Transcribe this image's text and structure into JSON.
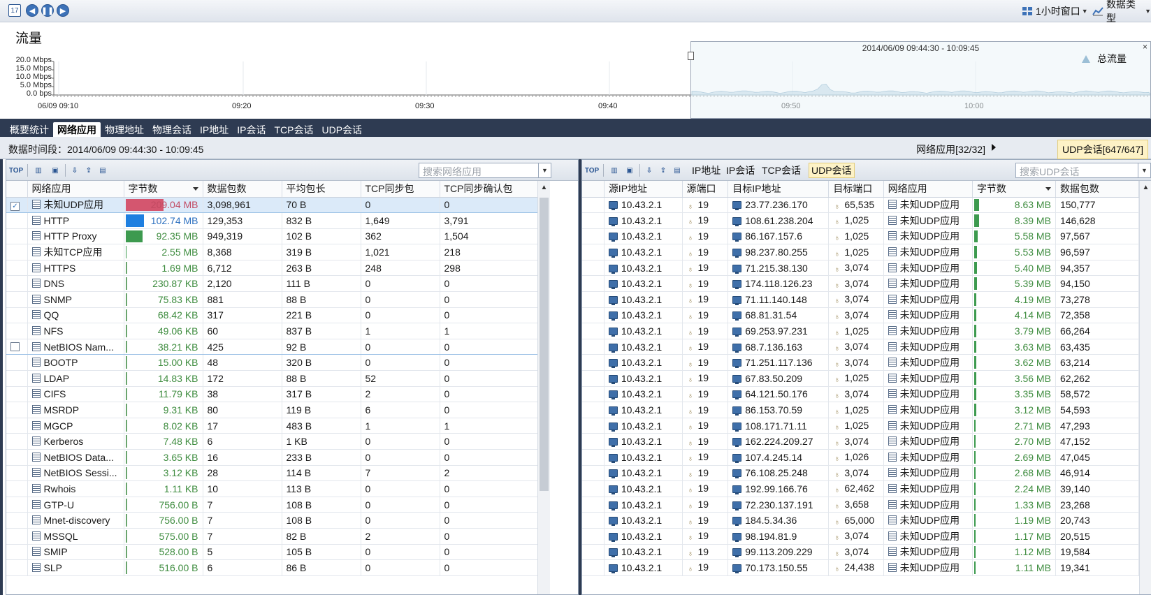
{
  "toolbar": {
    "window_label": "1小时窗口",
    "datatype_label": "数据类型"
  },
  "chart": {
    "title": "流量",
    "range_label": "2014/06/09  09:44:30 - 10:09:45",
    "legend_label": "总流量",
    "legend_color": "#9cbfd6",
    "y_ticks": [
      "20.0 Mbps",
      "15.0 Mbps",
      "10.0 Mbps",
      "5.0 Mbps",
      "0.0 bps"
    ],
    "x_ticks": [
      "06/09 09:10",
      "09:20",
      "09:30",
      "09:40",
      "09:50",
      "10:00"
    ]
  },
  "nav": {
    "tabs": [
      "概要统计",
      "网络应用",
      "物理地址",
      "物理会话",
      "IP地址",
      "IP会话",
      "TCP会话",
      "UDP会话"
    ],
    "active_index": 1
  },
  "timebar": {
    "period": "数据时间段：2014/06/09  09:44:30 - 10:09:45",
    "crumb_app": "网络应用[32/32]",
    "crumb_udp": "UDP会话[647/647]"
  },
  "left": {
    "search_placeholder": "搜索网络应用",
    "columns": [
      "网络应用",
      "字节数",
      "数据包数",
      "平均包长",
      "TCP同步包",
      "TCP同步确认包"
    ],
    "rows": [
      {
        "name": "未知UDP应用",
        "bytes": "209.04 MB",
        "bar": 1.0,
        "bar_color": "#d4566f",
        "packets": "3,098,961",
        "avg": "70 B",
        "syn": "0",
        "synack": "0",
        "checked": true,
        "selected": true
      },
      {
        "name": "HTTP",
        "bytes": "102.74 MB",
        "bar": 0.49,
        "bar_color": "#1e7fe0",
        "packets": "129,353",
        "avg": "832 B",
        "syn": "1,649",
        "synack": "3,791"
      },
      {
        "name": "HTTP Proxy",
        "bytes": "92.35 MB",
        "bar": 0.44,
        "bar_color": "#3d9a4f",
        "packets": "949,319",
        "avg": "102 B",
        "syn": "362",
        "synack": "1,504"
      },
      {
        "name": "未知TCP应用",
        "bytes": "2.55 MB",
        "bar": 0.012,
        "bar_color": "#3d9a4f",
        "packets": "8,368",
        "avg": "319 B",
        "syn": "1,021",
        "synack": "218"
      },
      {
        "name": "HTTPS",
        "bytes": "1.69 MB",
        "bar": 0.008,
        "bar_color": "#3d9a4f",
        "packets": "6,712",
        "avg": "263 B",
        "syn": "248",
        "synack": "298"
      },
      {
        "name": "DNS",
        "bytes": "230.87 KB",
        "bar": 0.001,
        "bar_color": "#3d9a4f",
        "packets": "2,120",
        "avg": "111 B",
        "syn": "0",
        "synack": "0"
      },
      {
        "name": "SNMP",
        "bytes": "75.83 KB",
        "bar": 0,
        "bar_color": "#3d9a4f",
        "packets": "881",
        "avg": "88 B",
        "syn": "0",
        "synack": "0"
      },
      {
        "name": "QQ",
        "bytes": "68.42 KB",
        "bar": 0,
        "bar_color": "#3d9a4f",
        "packets": "317",
        "avg": "221 B",
        "syn": "0",
        "synack": "0"
      },
      {
        "name": "NFS",
        "bytes": "49.06 KB",
        "bar": 0,
        "bar_color": "#3d9a4f",
        "packets": "60",
        "avg": "837 B",
        "syn": "1",
        "synack": "1"
      },
      {
        "name": "NetBIOS Nam...",
        "bytes": "38.21 KB",
        "bar": 0,
        "bar_color": "#3d9a4f",
        "packets": "425",
        "avg": "92 B",
        "syn": "0",
        "synack": "0",
        "checked": false,
        "hover": true
      },
      {
        "name": "BOOTP",
        "bytes": "15.00 KB",
        "bar": 0,
        "bar_color": "#3d9a4f",
        "packets": "48",
        "avg": "320 B",
        "syn": "0",
        "synack": "0"
      },
      {
        "name": "LDAP",
        "bytes": "14.83 KB",
        "bar": 0,
        "bar_color": "#3d9a4f",
        "packets": "172",
        "avg": "88 B",
        "syn": "52",
        "synack": "0"
      },
      {
        "name": "CIFS",
        "bytes": "11.79 KB",
        "bar": 0,
        "bar_color": "#3d9a4f",
        "packets": "38",
        "avg": "317 B",
        "syn": "2",
        "synack": "0"
      },
      {
        "name": "MSRDP",
        "bytes": "9.31 KB",
        "bar": 0,
        "bar_color": "#3d9a4f",
        "packets": "80",
        "avg": "119 B",
        "syn": "6",
        "synack": "0"
      },
      {
        "name": "MGCP",
        "bytes": "8.02 KB",
        "bar": 0,
        "bar_color": "#3d9a4f",
        "packets": "17",
        "avg": "483 B",
        "syn": "1",
        "synack": "1"
      },
      {
        "name": "Kerberos",
        "bytes": "7.48 KB",
        "bar": 0,
        "bar_color": "#3d9a4f",
        "packets": "6",
        "avg": "1 KB",
        "syn": "0",
        "synack": "0"
      },
      {
        "name": "NetBIOS Data...",
        "bytes": "3.65 KB",
        "bar": 0,
        "bar_color": "#3d9a4f",
        "packets": "16",
        "avg": "233 B",
        "syn": "0",
        "synack": "0"
      },
      {
        "name": "NetBIOS Sessi...",
        "bytes": "3.12 KB",
        "bar": 0,
        "bar_color": "#3d9a4f",
        "packets": "28",
        "avg": "114 B",
        "syn": "7",
        "synack": "2"
      },
      {
        "name": "Rwhois",
        "bytes": "1.11 KB",
        "bar": 0,
        "bar_color": "#3d9a4f",
        "packets": "10",
        "avg": "113 B",
        "syn": "0",
        "synack": "0"
      },
      {
        "name": "GTP-U",
        "bytes": "756.00 B",
        "bar": 0,
        "bar_color": "#3d9a4f",
        "packets": "7",
        "avg": "108 B",
        "syn": "0",
        "synack": "0"
      },
      {
        "name": "Mnet-discovery",
        "bytes": "756.00 B",
        "bar": 0,
        "bar_color": "#3d9a4f",
        "packets": "7",
        "avg": "108 B",
        "syn": "0",
        "synack": "0"
      },
      {
        "name": "MSSQL",
        "bytes": "575.00 B",
        "bar": 0,
        "bar_color": "#3d9a4f",
        "packets": "7",
        "avg": "82 B",
        "syn": "2",
        "synack": "0"
      },
      {
        "name": "SMIP",
        "bytes": "528.00 B",
        "bar": 0,
        "bar_color": "#3d9a4f",
        "packets": "5",
        "avg": "105 B",
        "syn": "0",
        "synack": "0"
      },
      {
        "name": "SLP",
        "bytes": "516.00 B",
        "bar": 0,
        "bar_color": "#3d9a4f",
        "packets": "6",
        "avg": "86 B",
        "syn": "0",
        "synack": "0"
      }
    ]
  },
  "right": {
    "subtabs": [
      "IP地址",
      "IP会话",
      "TCP会话",
      "UDP会话"
    ],
    "active_subtab": 3,
    "search_placeholder": "搜索UDP会话",
    "columns": [
      "源IP地址",
      "源端口",
      "目标IP地址",
      "目标端口",
      "网络应用",
      "字节数",
      "数据包数"
    ],
    "rows": [
      {
        "src": "10.43.2.1",
        "sport": "19",
        "dst": "23.77.236.170",
        "dport": "65,535",
        "app": "未知UDP应用",
        "bytes": "8.63 MB",
        "packets": "150,777"
      },
      {
        "src": "10.43.2.1",
        "sport": "19",
        "dst": "108.61.238.204",
        "dport": "1,025",
        "app": "未知UDP应用",
        "bytes": "8.39 MB",
        "packets": "146,628"
      },
      {
        "src": "10.43.2.1",
        "sport": "19",
        "dst": "86.167.157.6",
        "dport": "1,025",
        "app": "未知UDP应用",
        "bytes": "5.58 MB",
        "packets": "97,567"
      },
      {
        "src": "10.43.2.1",
        "sport": "19",
        "dst": "98.237.80.255",
        "dport": "1,025",
        "app": "未知UDP应用",
        "bytes": "5.53 MB",
        "packets": "96,597"
      },
      {
        "src": "10.43.2.1",
        "sport": "19",
        "dst": "71.215.38.130",
        "dport": "3,074",
        "app": "未知UDP应用",
        "bytes": "5.40 MB",
        "packets": "94,357"
      },
      {
        "src": "10.43.2.1",
        "sport": "19",
        "dst": "174.118.126.23",
        "dport": "3,074",
        "app": "未知UDP应用",
        "bytes": "5.39 MB",
        "packets": "94,150"
      },
      {
        "src": "10.43.2.1",
        "sport": "19",
        "dst": "71.11.140.148",
        "dport": "3,074",
        "app": "未知UDP应用",
        "bytes": "4.19 MB",
        "packets": "73,278"
      },
      {
        "src": "10.43.2.1",
        "sport": "19",
        "dst": "68.81.31.54",
        "dport": "3,074",
        "app": "未知UDP应用",
        "bytes": "4.14 MB",
        "packets": "72,358"
      },
      {
        "src": "10.43.2.1",
        "sport": "19",
        "dst": "69.253.97.231",
        "dport": "1,025",
        "app": "未知UDP应用",
        "bytes": "3.79 MB",
        "packets": "66,264"
      },
      {
        "src": "10.43.2.1",
        "sport": "19",
        "dst": "68.7.136.163",
        "dport": "3,074",
        "app": "未知UDP应用",
        "bytes": "3.63 MB",
        "packets": "63,435"
      },
      {
        "src": "10.43.2.1",
        "sport": "19",
        "dst": "71.251.117.136",
        "dport": "3,074",
        "app": "未知UDP应用",
        "bytes": "3.62 MB",
        "packets": "63,214"
      },
      {
        "src": "10.43.2.1",
        "sport": "19",
        "dst": "67.83.50.209",
        "dport": "1,025",
        "app": "未知UDP应用",
        "bytes": "3.56 MB",
        "packets": "62,262"
      },
      {
        "src": "10.43.2.1",
        "sport": "19",
        "dst": "64.121.50.176",
        "dport": "3,074",
        "app": "未知UDP应用",
        "bytes": "3.35 MB",
        "packets": "58,572"
      },
      {
        "src": "10.43.2.1",
        "sport": "19",
        "dst": "86.153.70.59",
        "dport": "1,025",
        "app": "未知UDP应用",
        "bytes": "3.12 MB",
        "packets": "54,593"
      },
      {
        "src": "10.43.2.1",
        "sport": "19",
        "dst": "108.171.71.11",
        "dport": "1,025",
        "app": "未知UDP应用",
        "bytes": "2.71 MB",
        "packets": "47,293"
      },
      {
        "src": "10.43.2.1",
        "sport": "19",
        "dst": "162.224.209.27",
        "dport": "3,074",
        "app": "未知UDP应用",
        "bytes": "2.70 MB",
        "packets": "47,152"
      },
      {
        "src": "10.43.2.1",
        "sport": "19",
        "dst": "107.4.245.14",
        "dport": "1,026",
        "app": "未知UDP应用",
        "bytes": "2.69 MB",
        "packets": "47,045"
      },
      {
        "src": "10.43.2.1",
        "sport": "19",
        "dst": "76.108.25.248",
        "dport": "3,074",
        "app": "未知UDP应用",
        "bytes": "2.68 MB",
        "packets": "46,914"
      },
      {
        "src": "10.43.2.1",
        "sport": "19",
        "dst": "192.99.166.76",
        "dport": "62,462",
        "app": "未知UDP应用",
        "bytes": "2.24 MB",
        "packets": "39,140"
      },
      {
        "src": "10.43.2.1",
        "sport": "19",
        "dst": "72.230.137.191",
        "dport": "3,658",
        "app": "未知UDP应用",
        "bytes": "1.33 MB",
        "packets": "23,268"
      },
      {
        "src": "10.43.2.1",
        "sport": "19",
        "dst": "184.5.34.36",
        "dport": "65,000",
        "app": "未知UDP应用",
        "bytes": "1.19 MB",
        "packets": "20,743"
      },
      {
        "src": "10.43.2.1",
        "sport": "19",
        "dst": "98.194.81.9",
        "dport": "3,074",
        "app": "未知UDP应用",
        "bytes": "1.17 MB",
        "packets": "20,515"
      },
      {
        "src": "10.43.2.1",
        "sport": "19",
        "dst": "99.113.209.229",
        "dport": "3,074",
        "app": "未知UDP应用",
        "bytes": "1.12 MB",
        "packets": "19,584"
      },
      {
        "src": "10.43.2.1",
        "sport": "19",
        "dst": "70.173.150.55",
        "dport": "24,438",
        "app": "未知UDP应用",
        "bytes": "1.11 MB",
        "packets": "19,341"
      }
    ]
  }
}
